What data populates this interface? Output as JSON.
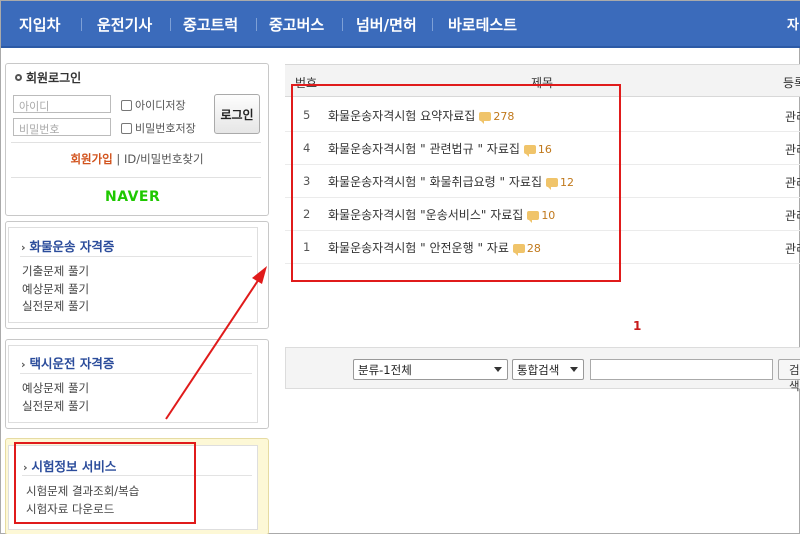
{
  "nav": {
    "items": [
      "지입차",
      "운전기사",
      "중고트럭",
      "중고버스",
      "넘버/면허",
      "바로테스트"
    ],
    "cut_right": "자"
  },
  "login": {
    "title": "회원로그인",
    "id_placeholder": "아이디",
    "pw_placeholder": "비밀번호",
    "save_id": "아이디저장",
    "save_pw": "비밀번호저장",
    "button": "로그인",
    "join": "회원가입",
    "divider": "|",
    "find": "ID/비밀번호찾기",
    "naver": "NAVER"
  },
  "sections": [
    {
      "title": "화물운송 자격증",
      "links": [
        "기출문제 풀기",
        "예상문제 풀기",
        "실전문제 풀기"
      ]
    },
    {
      "title": "택시운전 자격증",
      "links": [
        "예상문제 풀기",
        "실전문제 풀기"
      ]
    },
    {
      "title": "시험정보 서비스",
      "links": [
        "시험문제 결과조회/복습",
        "시험자료 다운로드"
      ]
    }
  ],
  "table": {
    "headers": {
      "num": "번호",
      "subject": "제목",
      "author": "등록"
    },
    "rows": [
      {
        "num": "5",
        "subject": "화물운송자격시험 요약자료집",
        "comments": "278",
        "author": "관리"
      },
      {
        "num": "4",
        "subject": "화물운송자격시험 \" 관련법규 \" 자료집",
        "comments": "16",
        "author": "관리"
      },
      {
        "num": "3",
        "subject": "화물운송자격시험 \" 화물취급요령 \" 자료집",
        "comments": "12",
        "author": "관리"
      },
      {
        "num": "2",
        "subject": "화물운송자격시험 \"운송서비스\" 자료집",
        "comments": "10",
        "author": "관리"
      },
      {
        "num": "1",
        "subject": "화물운송자격시험 \" 안전운행 \" 자료",
        "comments": "28",
        "author": "관리"
      }
    ]
  },
  "pagination": {
    "current": "1"
  },
  "search": {
    "category": "분류-1전체",
    "scope": "통합검색",
    "query": "",
    "button": "검색"
  },
  "colors": {
    "nav": "#3b6bbb",
    "highlight": "#e01b1b",
    "naver": "#1ec800"
  }
}
